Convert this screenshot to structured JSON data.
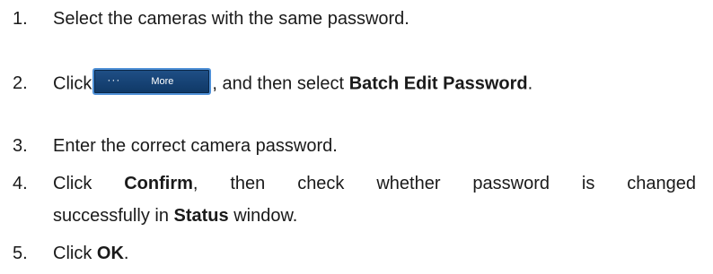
{
  "steps": [
    {
      "number": "1.",
      "text": "Select the cameras with the same password."
    },
    {
      "number": "2.",
      "text_before": "Click",
      "button": {
        "icon": "more-dots-icon",
        "dots": "···",
        "label": "More"
      },
      "text_after": ", and then select",
      "bold": "Batch Edit Password",
      "end": "."
    },
    {
      "number": "3.",
      "text": "Enter the correct camera password."
    },
    {
      "number": "4.",
      "words": [
        "Click",
        "Confirm,",
        "then",
        "check",
        "whether",
        "password",
        "is",
        "changed"
      ],
      "bold_word": "Confirm",
      "line2_before": "successfully in",
      "line2_bold": "Status",
      "line2_after": "window."
    },
    {
      "number": "5.",
      "text_before": "Click",
      "bold": "OK",
      "end": "."
    }
  ],
  "colors": {
    "button_bg": "#1f4f86",
    "button_border": "#4d8fd6",
    "text": "#1a1a1a"
  }
}
